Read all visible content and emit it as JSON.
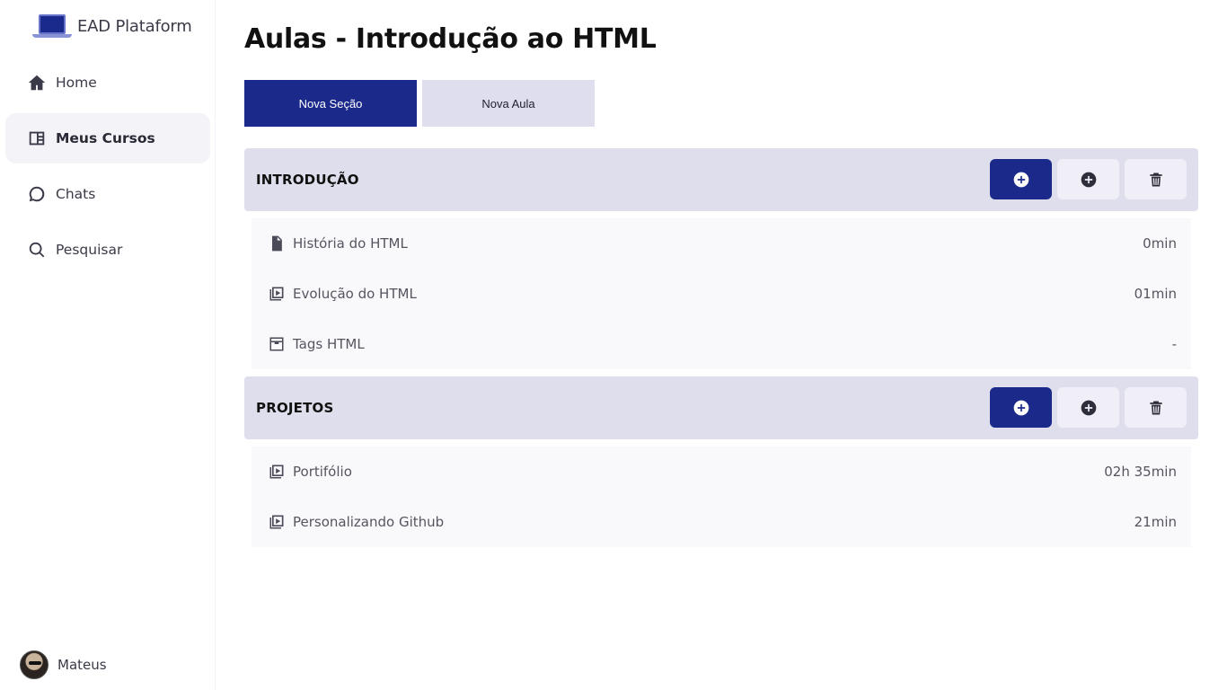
{
  "brand": {
    "name": "EAD Plataform",
    "logo_icon": "laptop-icon",
    "logo_color": "#1a2a8c"
  },
  "nav": {
    "items": [
      {
        "label": "Home",
        "icon": "home-icon",
        "active": false
      },
      {
        "label": "Meus Cursos",
        "icon": "book-icon",
        "active": true
      },
      {
        "label": "Chats",
        "icon": "chat-icon",
        "active": false
      },
      {
        "label": "Pesquisar",
        "icon": "search-icon",
        "active": false
      }
    ]
  },
  "user": {
    "name": "Mateus"
  },
  "page": {
    "title": "Aulas - Introdução ao HTML"
  },
  "actions": {
    "new_section": "Nova Seção",
    "new_lesson": "Nova Aula"
  },
  "colors": {
    "primary": "#1b2a8a",
    "section_bg": "#dfdeec",
    "lesson_bg": "#f9f9fc"
  },
  "sections": [
    {
      "title": "INTRODUÇÃO",
      "lessons": [
        {
          "name": "História do HTML",
          "duration": "0min",
          "type_icon": "document-icon"
        },
        {
          "name": "Evolução do HTML",
          "duration": "01min",
          "type_icon": "video-icon"
        },
        {
          "name": "Tags HTML",
          "duration": "-",
          "type_icon": "inbox-icon"
        }
      ]
    },
    {
      "title": "PROJETOS",
      "lessons": [
        {
          "name": "Portifólio",
          "duration": "02h 35min",
          "type_icon": "video-icon"
        },
        {
          "name": "Personalizando Github",
          "duration": "21min",
          "type_icon": "video-icon"
        }
      ]
    }
  ]
}
